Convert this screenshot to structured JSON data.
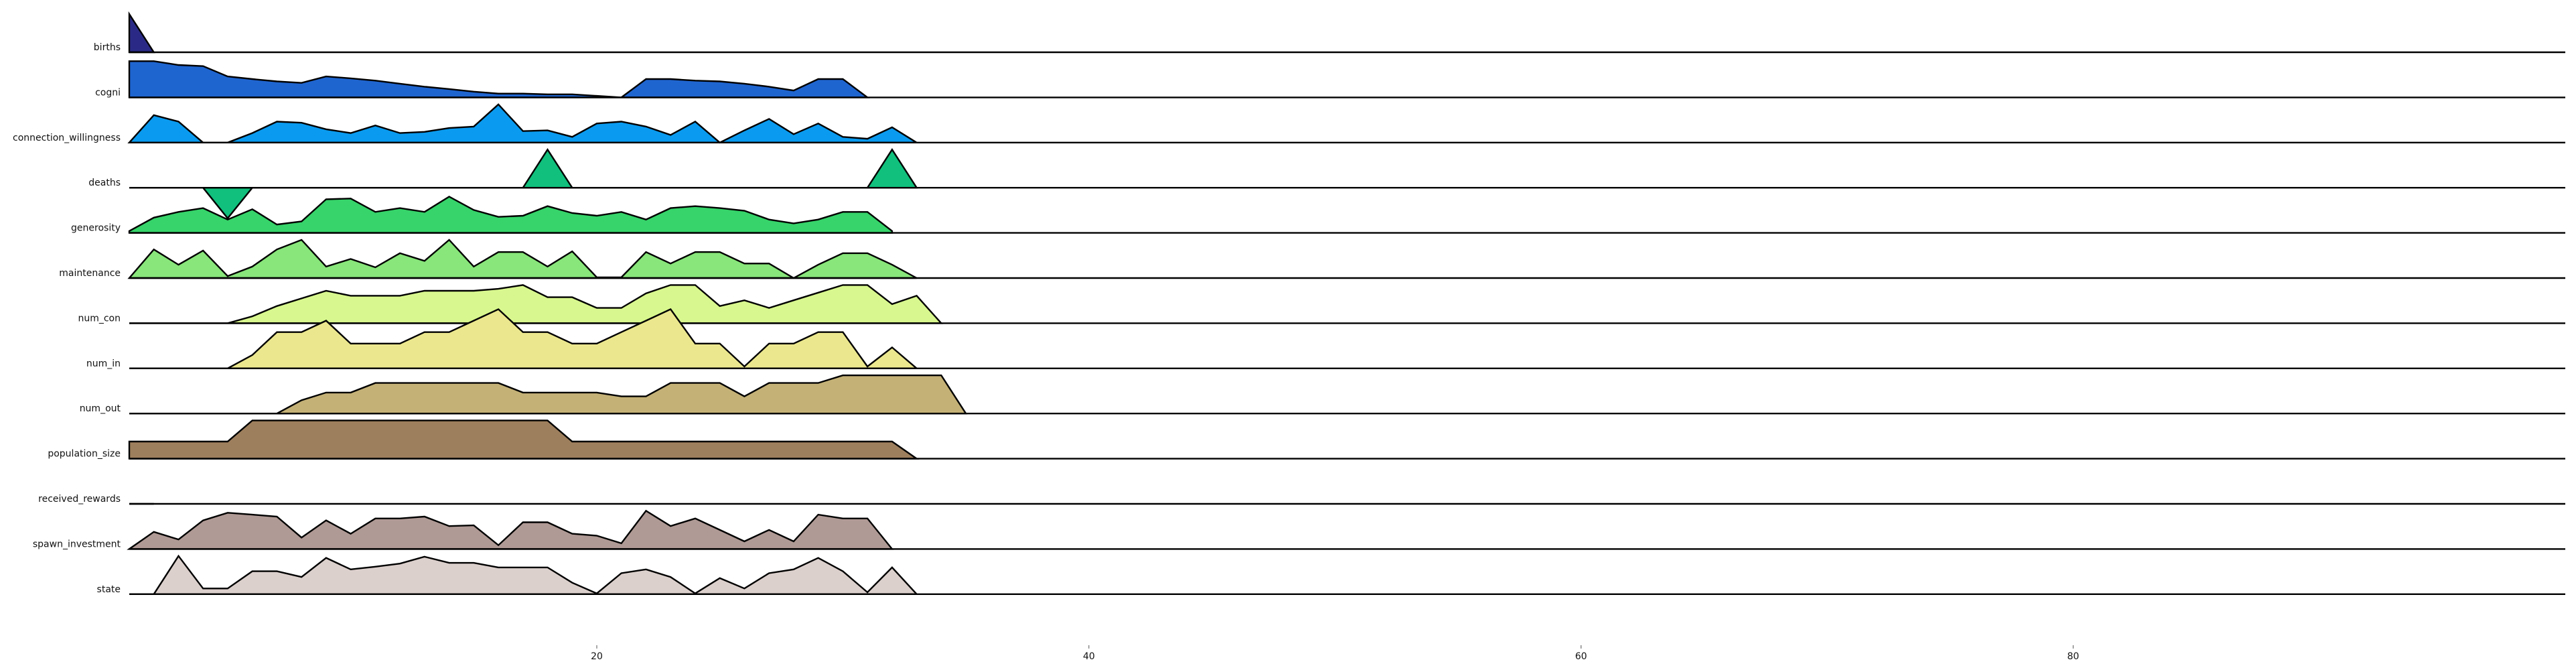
{
  "chart_data": {
    "type": "area",
    "subtype": "ridgeline",
    "title": "",
    "xlabel": "",
    "ylabel": "",
    "grid": false,
    "legend": "none",
    "x_start": 1,
    "xlim": [
      1,
      100
    ],
    "xticks": [
      {
        "value": 20,
        "label": "20"
      },
      {
        "value": 40,
        "label": "40"
      },
      {
        "value": 60,
        "label": "60"
      },
      {
        "value": 80,
        "label": "80"
      }
    ],
    "series": [
      {
        "name": "births",
        "color": "#2a2a86",
        "values": [
          1,
          0
        ]
      },
      {
        "name": "cogni",
        "color": "#1f65d0",
        "values": [
          0.95,
          0.95,
          0.85,
          0.82,
          0.55,
          0.48,
          0.42,
          0.38,
          0.55,
          0.5,
          0.44,
          0.36,
          0.28,
          0.22,
          0.15,
          0.1,
          0.1,
          0.08,
          0.08,
          0.04,
          0.0,
          0.48,
          0.48,
          0.44,
          0.42,
          0.36,
          0.28,
          0.18,
          0.48,
          0.48,
          0.0
        ]
      },
      {
        "name": "connection_willingness",
        "color": "#0a9bf0",
        "values": [
          0.0,
          0.72,
          0.55,
          0.0,
          0.0,
          0.25,
          0.55,
          0.52,
          0.35,
          0.25,
          0.45,
          0.25,
          0.28,
          0.38,
          0.42,
          1.0,
          0.3,
          0.32,
          0.15,
          0.5,
          0.55,
          0.42,
          0.2,
          0.55,
          0.0,
          0.32,
          0.62,
          0.22,
          0.5,
          0.15,
          0.1,
          0.4,
          0.0
        ]
      },
      {
        "name": "deaths",
        "color": "#10c07c",
        "values": [
          0,
          0,
          0,
          0,
          -0.8,
          0,
          0,
          0,
          0,
          0,
          0,
          0,
          0,
          0,
          0,
          0,
          0,
          1,
          0,
          0,
          0,
          0,
          0,
          0,
          0,
          0,
          0,
          0,
          0,
          0,
          0,
          1,
          0
        ]
      },
      {
        "name": "generosity",
        "color": "#36d46a",
        "values": [
          0.05,
          0.4,
          0.55,
          0.65,
          0.35,
          0.62,
          0.22,
          0.3,
          0.88,
          0.9,
          0.55,
          0.65,
          0.55,
          0.95,
          0.6,
          0.42,
          0.45,
          0.7,
          0.52,
          0.45,
          0.55,
          0.35,
          0.65,
          0.7,
          0.65,
          0.58,
          0.35,
          0.25,
          0.35,
          0.55,
          0.55,
          0.05
        ]
      },
      {
        "name": "maintenance",
        "color": "#88e67a",
        "values": [
          0.0,
          0.75,
          0.35,
          0.72,
          0.05,
          0.3,
          0.75,
          1.0,
          0.3,
          0.5,
          0.28,
          0.65,
          0.45,
          1.0,
          0.3,
          0.68,
          0.68,
          0.3,
          0.7,
          0.02,
          0.02,
          0.68,
          0.38,
          0.68,
          0.68,
          0.38,
          0.38,
          0.0,
          0.35,
          0.65,
          0.65,
          0.35,
          0.0
        ]
      },
      {
        "name": "num_con",
        "color": "#d8f78e",
        "values": [
          0,
          0,
          0,
          0,
          0,
          0.18,
          0.45,
          0.65,
          0.85,
          0.72,
          0.72,
          0.72,
          0.85,
          0.85,
          0.85,
          0.9,
          1.0,
          0.68,
          0.68,
          0.4,
          0.4,
          0.78,
          1.0,
          1.0,
          0.45,
          0.6,
          0.4,
          0.6,
          0.8,
          1.0,
          1.0,
          0.5,
          0.72,
          0.0
        ]
      },
      {
        "name": "num_in",
        "color": "#ebe78e",
        "values": [
          0,
          0,
          0,
          0,
          0,
          0.35,
          0.95,
          0.95,
          1.25,
          0.65,
          0.65,
          0.65,
          0.95,
          0.95,
          1.25,
          1.55,
          0.95,
          0.95,
          0.65,
          0.65,
          0.95,
          1.25,
          1.55,
          0.65,
          0.65,
          0.05,
          0.65,
          0.65,
          0.95,
          0.95,
          0.05,
          0.55,
          0.0
        ]
      },
      {
        "name": "num_out",
        "color": "#c4b176",
        "values": [
          0,
          0,
          0,
          0,
          0,
          0,
          0,
          0.35,
          0.55,
          0.55,
          0.8,
          0.8,
          0.8,
          0.8,
          0.8,
          0.8,
          0.55,
          0.55,
          0.55,
          0.55,
          0.45,
          0.45,
          0.8,
          0.8,
          0.8,
          0.45,
          0.8,
          0.8,
          0.8,
          1.0,
          1.0,
          1.0,
          1.0,
          1.0,
          0.0
        ]
      },
      {
        "name": "population_size",
        "color": "#9e7f5d",
        "values": [
          0.45,
          0.45,
          0.45,
          0.45,
          0.45,
          1.0,
          1.0,
          1.0,
          1.0,
          1.0,
          1.0,
          1.0,
          1.0,
          1.0,
          1.0,
          1.0,
          1.0,
          1.0,
          0.45,
          0.45,
          0.45,
          0.45,
          0.45,
          0.45,
          0.45,
          0.45,
          0.45,
          0.45,
          0.45,
          0.45,
          0.45,
          0.45,
          0.0
        ]
      },
      {
        "name": "received_rewards",
        "color": "#7a7a7a",
        "values": [
          0,
          0
        ]
      },
      {
        "name": "spawn_investment",
        "color": "#b09a95",
        "values": [
          0.0,
          0.45,
          0.25,
          0.75,
          0.95,
          0.9,
          0.85,
          0.3,
          0.75,
          0.4,
          0.8,
          0.8,
          0.85,
          0.6,
          0.62,
          0.1,
          0.7,
          0.7,
          0.4,
          0.35,
          0.15,
          1.0,
          0.6,
          0.8,
          0.5,
          0.2,
          0.5,
          0.2,
          0.9,
          0.8,
          0.8,
          0.0
        ]
      },
      {
        "name": "state",
        "color": "#dcd0cc",
        "values": [
          0.0,
          0.0,
          1.0,
          0.15,
          0.15,
          0.6,
          0.6,
          0.45,
          0.95,
          0.65,
          0.72,
          0.8,
          0.98,
          0.82,
          0.82,
          0.7,
          0.7,
          0.7,
          0.3,
          0.02,
          0.55,
          0.65,
          0.45,
          0.02,
          0.42,
          0.15,
          0.55,
          0.65,
          0.95,
          0.6,
          0.05,
          0.7,
          0.0
        ]
      }
    ]
  }
}
